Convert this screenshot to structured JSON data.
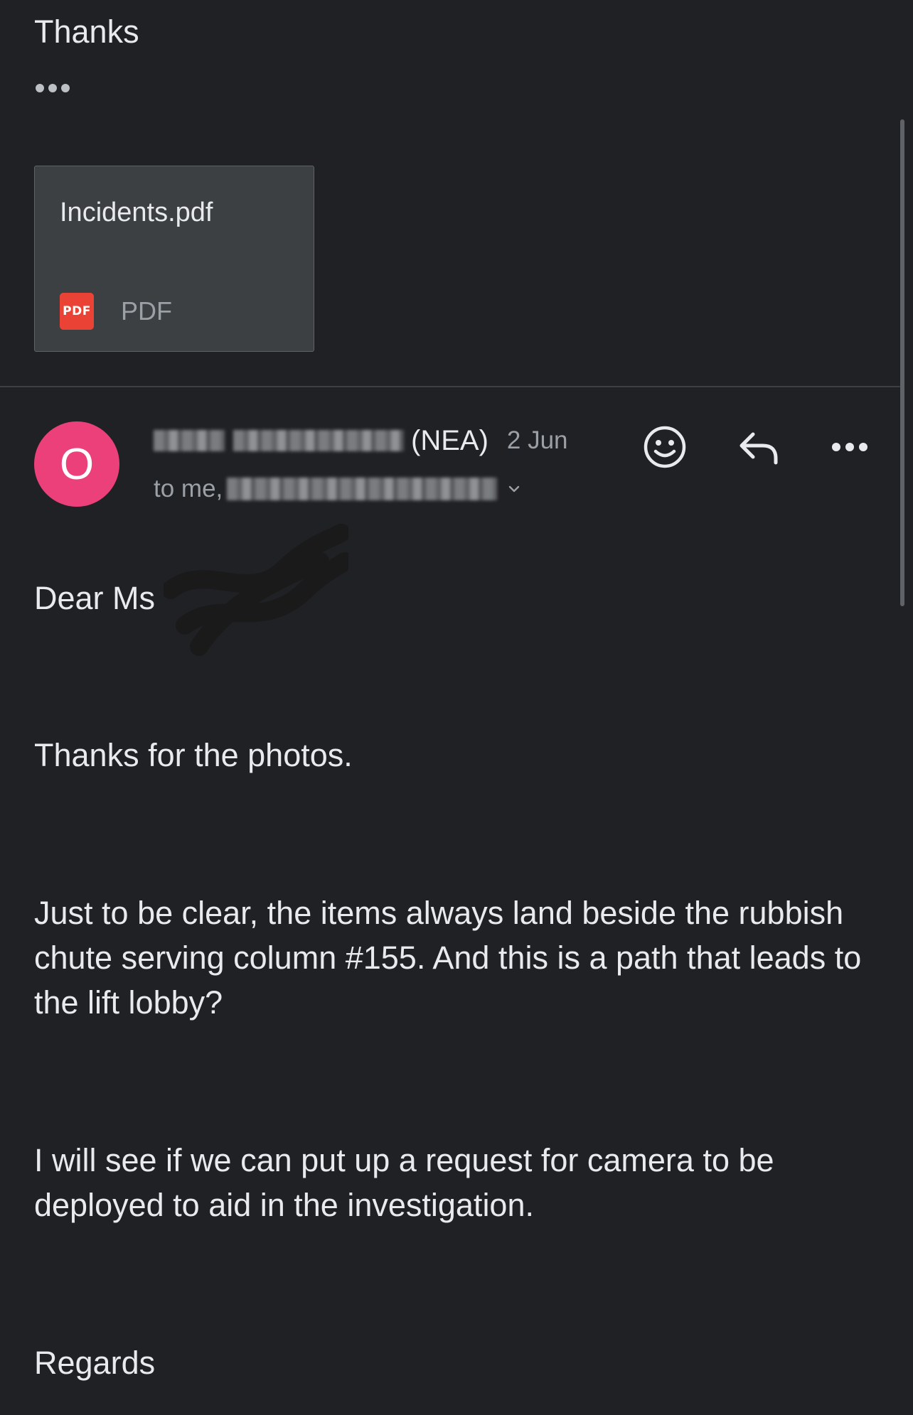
{
  "previous_message": {
    "text": "Thanks",
    "trimmed_content_icon": "ellipsis-icon"
  },
  "attachment": {
    "filename": "Incidents.pdf",
    "type_label": "PDF",
    "icon_label": "PDF",
    "icon": "pdf-file-icon",
    "icon_color": "#ea4335"
  },
  "message": {
    "avatar_letter": "O",
    "avatar_color": "#ec407a",
    "sender_org": "(NEA)",
    "date": "2 Jun",
    "recipients_prefix": "to me,",
    "actions": {
      "react_icon": "emoji-smile-icon",
      "reply_icon": "reply-icon",
      "more_icon": "more-options-icon"
    },
    "greeting": "Dear Ms",
    "paragraphs": [
      "Thanks for the photos.",
      "Just to be clear, the items always land beside the rubbish chute serving column #155. And this is a path that leads to the lift lobby?",
      "I will see if we can put up a request for camera to be deployed to aid in the investigation."
    ],
    "signoff": "Regards"
  },
  "colors": {
    "background": "#202124",
    "text_primary": "#e8eaed",
    "text_secondary": "#9aa0a6"
  }
}
